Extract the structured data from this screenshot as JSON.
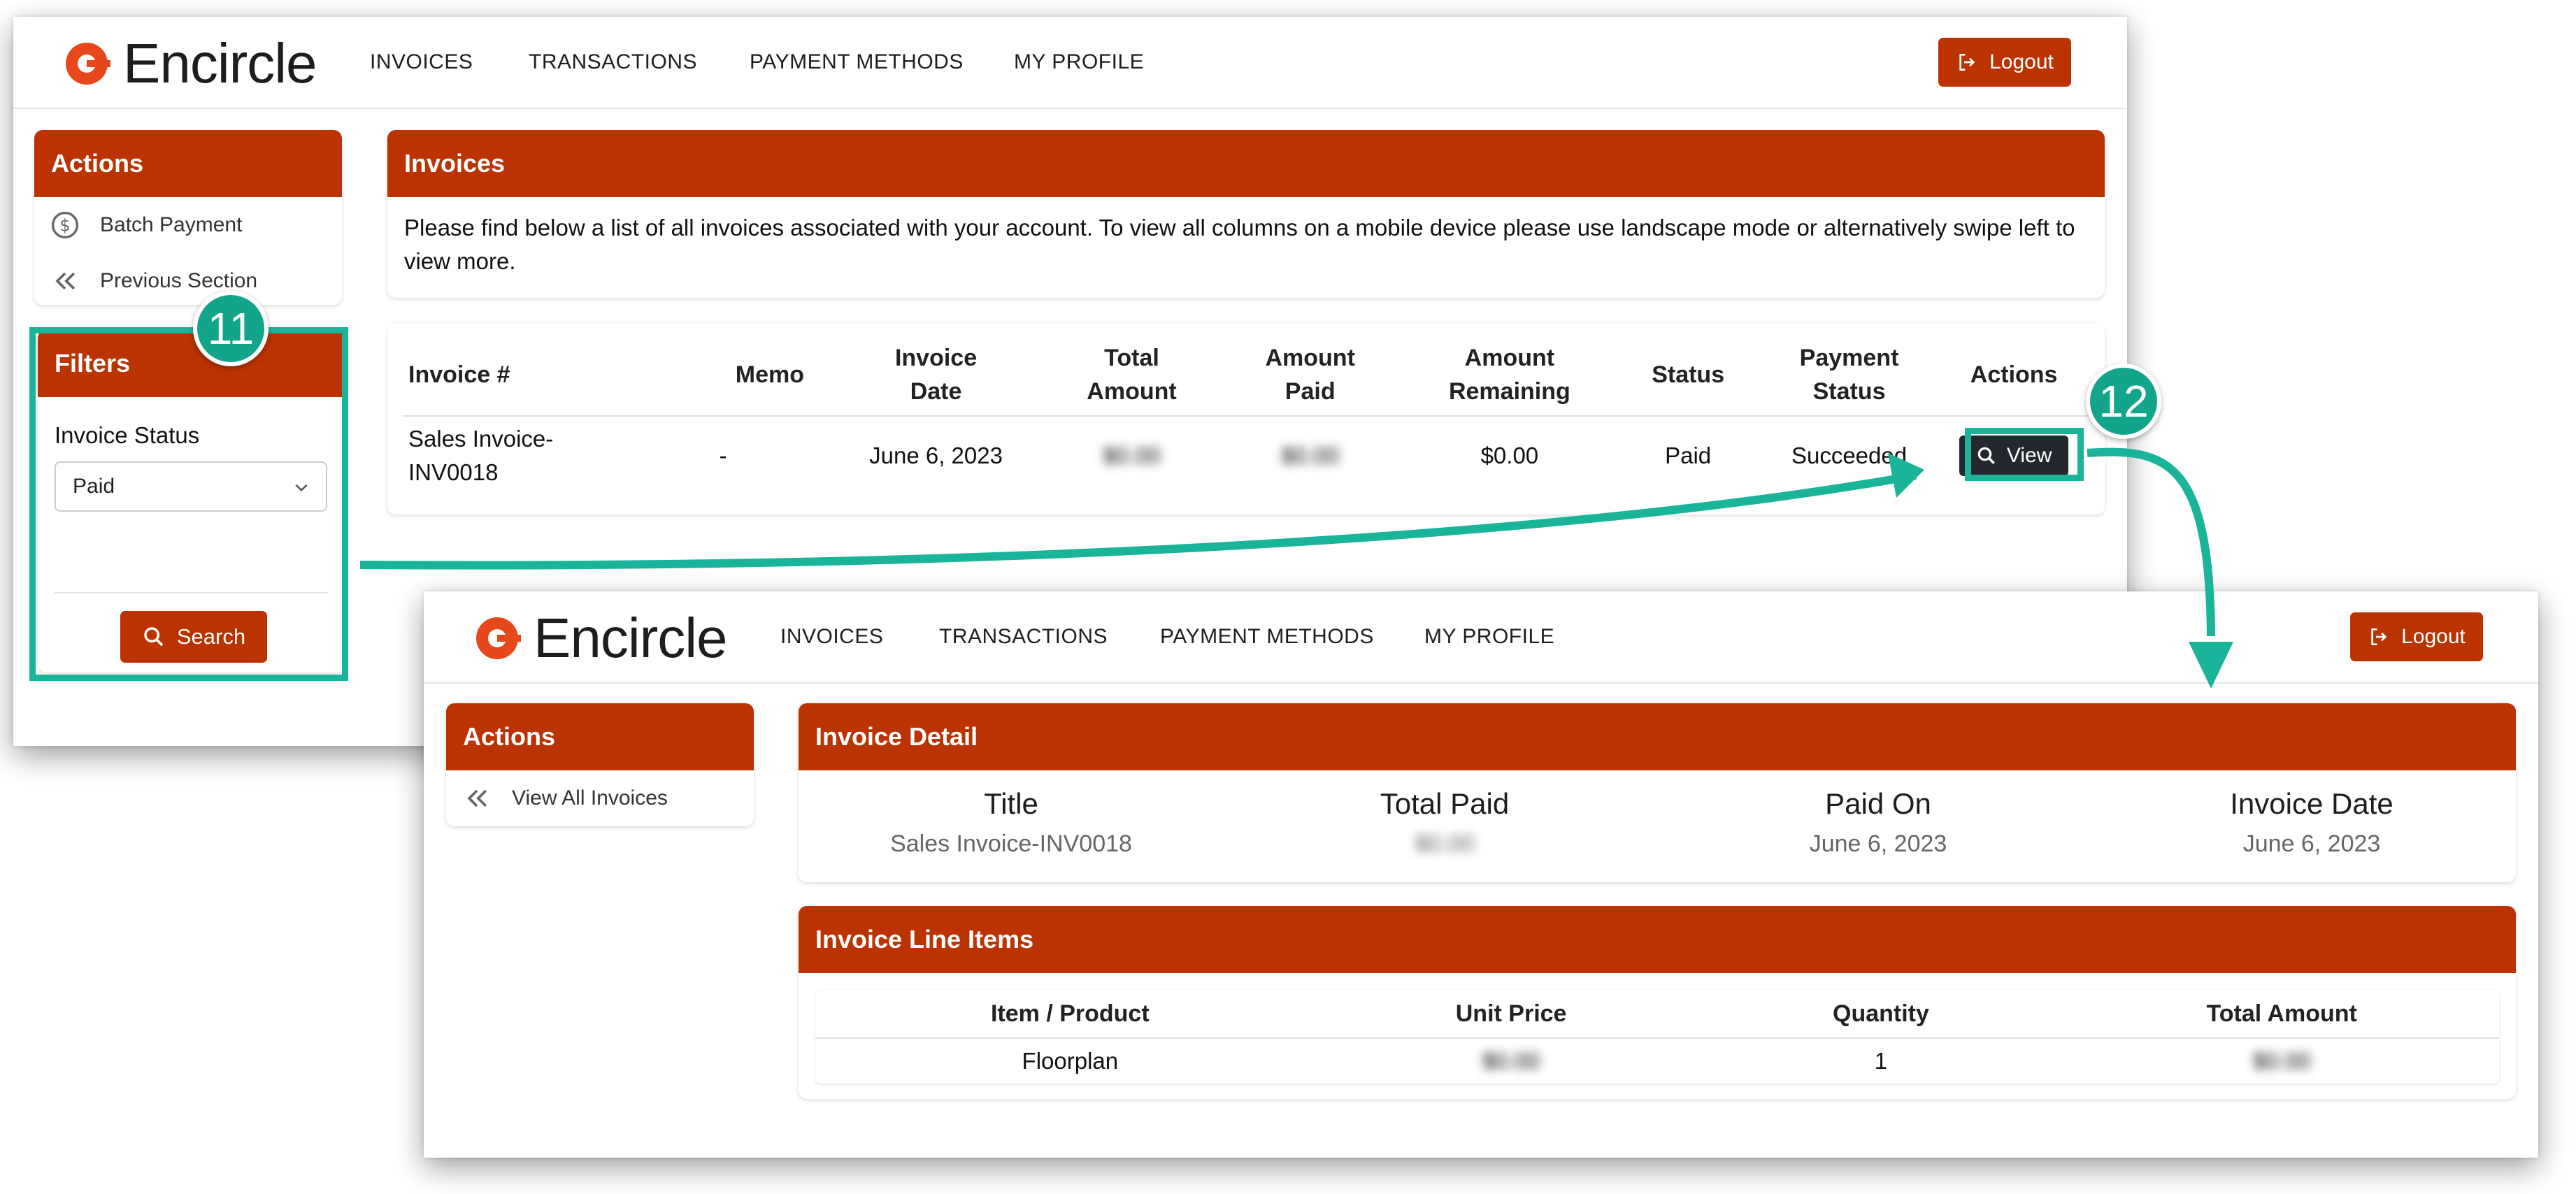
{
  "brand": {
    "name": "Encircle"
  },
  "nav": [
    "INVOICES",
    "TRANSACTIONS",
    "PAYMENT METHODS",
    "MY PROFILE"
  ],
  "logout_label": "Logout",
  "screen1": {
    "actions": {
      "title": "Actions",
      "items": [
        {
          "label": "Batch Payment",
          "icon": "dollar-circle-icon"
        },
        {
          "label": "Previous Section",
          "icon": "double-chevron-left-icon"
        }
      ]
    },
    "filters": {
      "title": "Filters",
      "status_label": "Invoice Status",
      "status_value": "Paid",
      "search_label": "Search"
    },
    "invoices": {
      "title": "Invoices",
      "description": "Please find below a list of all invoices associated with your account. To view all columns on a mobile device please use landscape mode or alternatively swipe left to view more."
    },
    "table": {
      "headers": [
        "Invoice #",
        "Memo",
        "Invoice Date",
        "Total Amount",
        "Amount Paid",
        "Amount Remaining",
        "Status",
        "Payment Status",
        "Actions"
      ],
      "rows": [
        {
          "invoice": "Sales Invoice-INV0018",
          "memo": "-",
          "date": "June 6, 2023",
          "total": "$0.00",
          "paid": "$0.00",
          "remaining": "$0.00",
          "status": "Paid",
          "payment_status": "Succeeded",
          "action": "View"
        }
      ]
    }
  },
  "screen2": {
    "actions": {
      "title": "Actions",
      "items": [
        {
          "label": "View All Invoices",
          "icon": "double-chevron-left-icon"
        }
      ]
    },
    "detail": {
      "title": "Invoice Detail",
      "columns": [
        {
          "label": "Title",
          "value": "Sales Invoice-INV0018"
        },
        {
          "label": "Total Paid",
          "value": "$0.00"
        },
        {
          "label": "Paid On",
          "value": "June 6, 2023"
        },
        {
          "label": "Invoice Date",
          "value": "June 6, 2023"
        }
      ]
    },
    "line_items": {
      "title": "Invoice Line Items",
      "headers": [
        "Item / Product",
        "Unit Price",
        "Quantity",
        "Total Amount"
      ],
      "rows": [
        {
          "item": "Floorplan",
          "unit_price": "$0.00",
          "quantity": "1",
          "total": "$0.00"
        }
      ]
    }
  },
  "callouts": [
    "11",
    "12"
  ],
  "colors": {
    "brand": "#bb3300",
    "logo": "#e6471b",
    "callout": "#19b49a",
    "view_button": "#22282e"
  }
}
